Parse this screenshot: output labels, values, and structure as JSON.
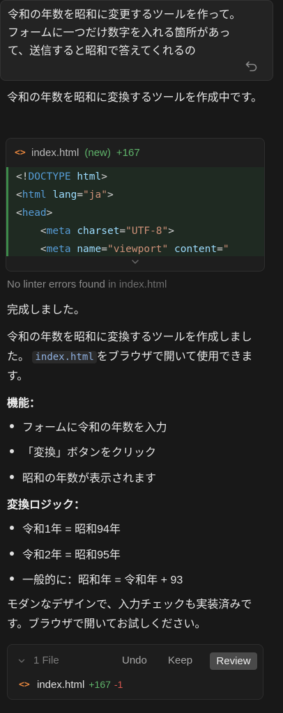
{
  "user_message": {
    "text": "令和の年数を昭和に変更するツールを作って。フォームに一つだけ数字を入れる箇所があって、送信すると昭和で答えてくれるの"
  },
  "assistant": {
    "intro": "令和の年数を昭和に変換するツールを作成中です。",
    "code_block": {
      "filename": "index.html",
      "status": "(new)",
      "added": "+167",
      "lines": [
        "<!DOCTYPE html>",
        "<html lang=\"ja\">",
        "<head>",
        "    <meta charset=\"UTF-8\">",
        "    <meta name=\"viewport\" content=\""
      ]
    },
    "linter": {
      "text": "No linter errors found",
      "file": "in index.html"
    },
    "done": "完成しました。",
    "summary_before": "令和の年数を昭和に変換するツールを作成しました。",
    "summary_code": "index.html",
    "summary_after": "をブラウザで開いて使用できます。",
    "features_heading": "機能：",
    "features": [
      "フォームに令和の年数を入力",
      "「変換」ボタンをクリック",
      "昭和の年数が表示されます"
    ],
    "logic_heading": "変換ロジック：",
    "logic": [
      "令和1年 = 昭和94年",
      "令和2年 = 昭和95年",
      "一般的に：昭和年 = 令和年 + 93"
    ],
    "closing": "モダンなデザインで、入力チェックも実装済みです。ブラウザで開いてお試しください。"
  },
  "footer": {
    "files": "1 File",
    "undo": "Undo",
    "keep": "Keep",
    "review": "Review",
    "file_name": "index.html",
    "added": "+167",
    "removed": "-1"
  },
  "colors": {
    "background": "#181818",
    "added_green": "#5fb36a",
    "removed_red": "#d9574f",
    "html_icon_orange": "#e5853d"
  }
}
